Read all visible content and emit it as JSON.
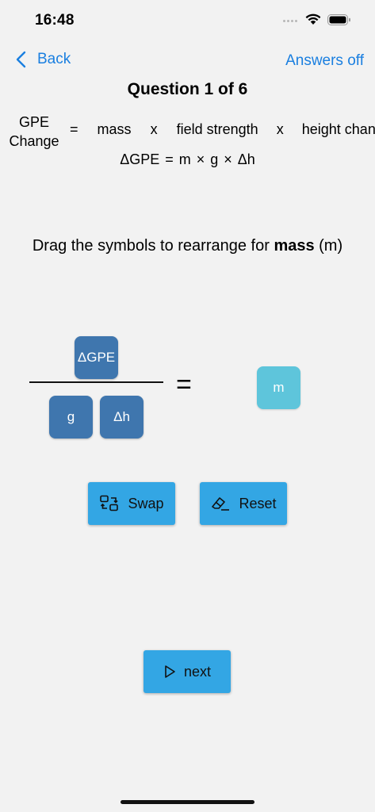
{
  "status_bar": {
    "time": "16:48"
  },
  "nav": {
    "back_label": "Back",
    "answers_label": "Answers off"
  },
  "title": "Question 1 of 6",
  "word_equation": {
    "gpe_line1": "GPE",
    "gpe_line2": "Change",
    "equals": "=",
    "mass": "mass",
    "times": "x",
    "field_strength": "field strength",
    "height_change": "height change"
  },
  "symbol_equation": "ΔGPE = m × g × Δh",
  "instruction": {
    "prefix": "Drag the symbols to rearrange for ",
    "bold": "mass",
    "suffix": " (m)"
  },
  "fraction": {
    "numerator": "ΔGPE",
    "denominator": [
      "g",
      "Δh"
    ],
    "equals": "=",
    "answer": "m"
  },
  "buttons": {
    "swap": "Swap",
    "reset": "Reset",
    "next": "next"
  },
  "colors": {
    "accent": "#1a7fe0",
    "tile": "#3f76ae",
    "answer_tile": "#5ec5db",
    "button": "#33a6e4"
  }
}
